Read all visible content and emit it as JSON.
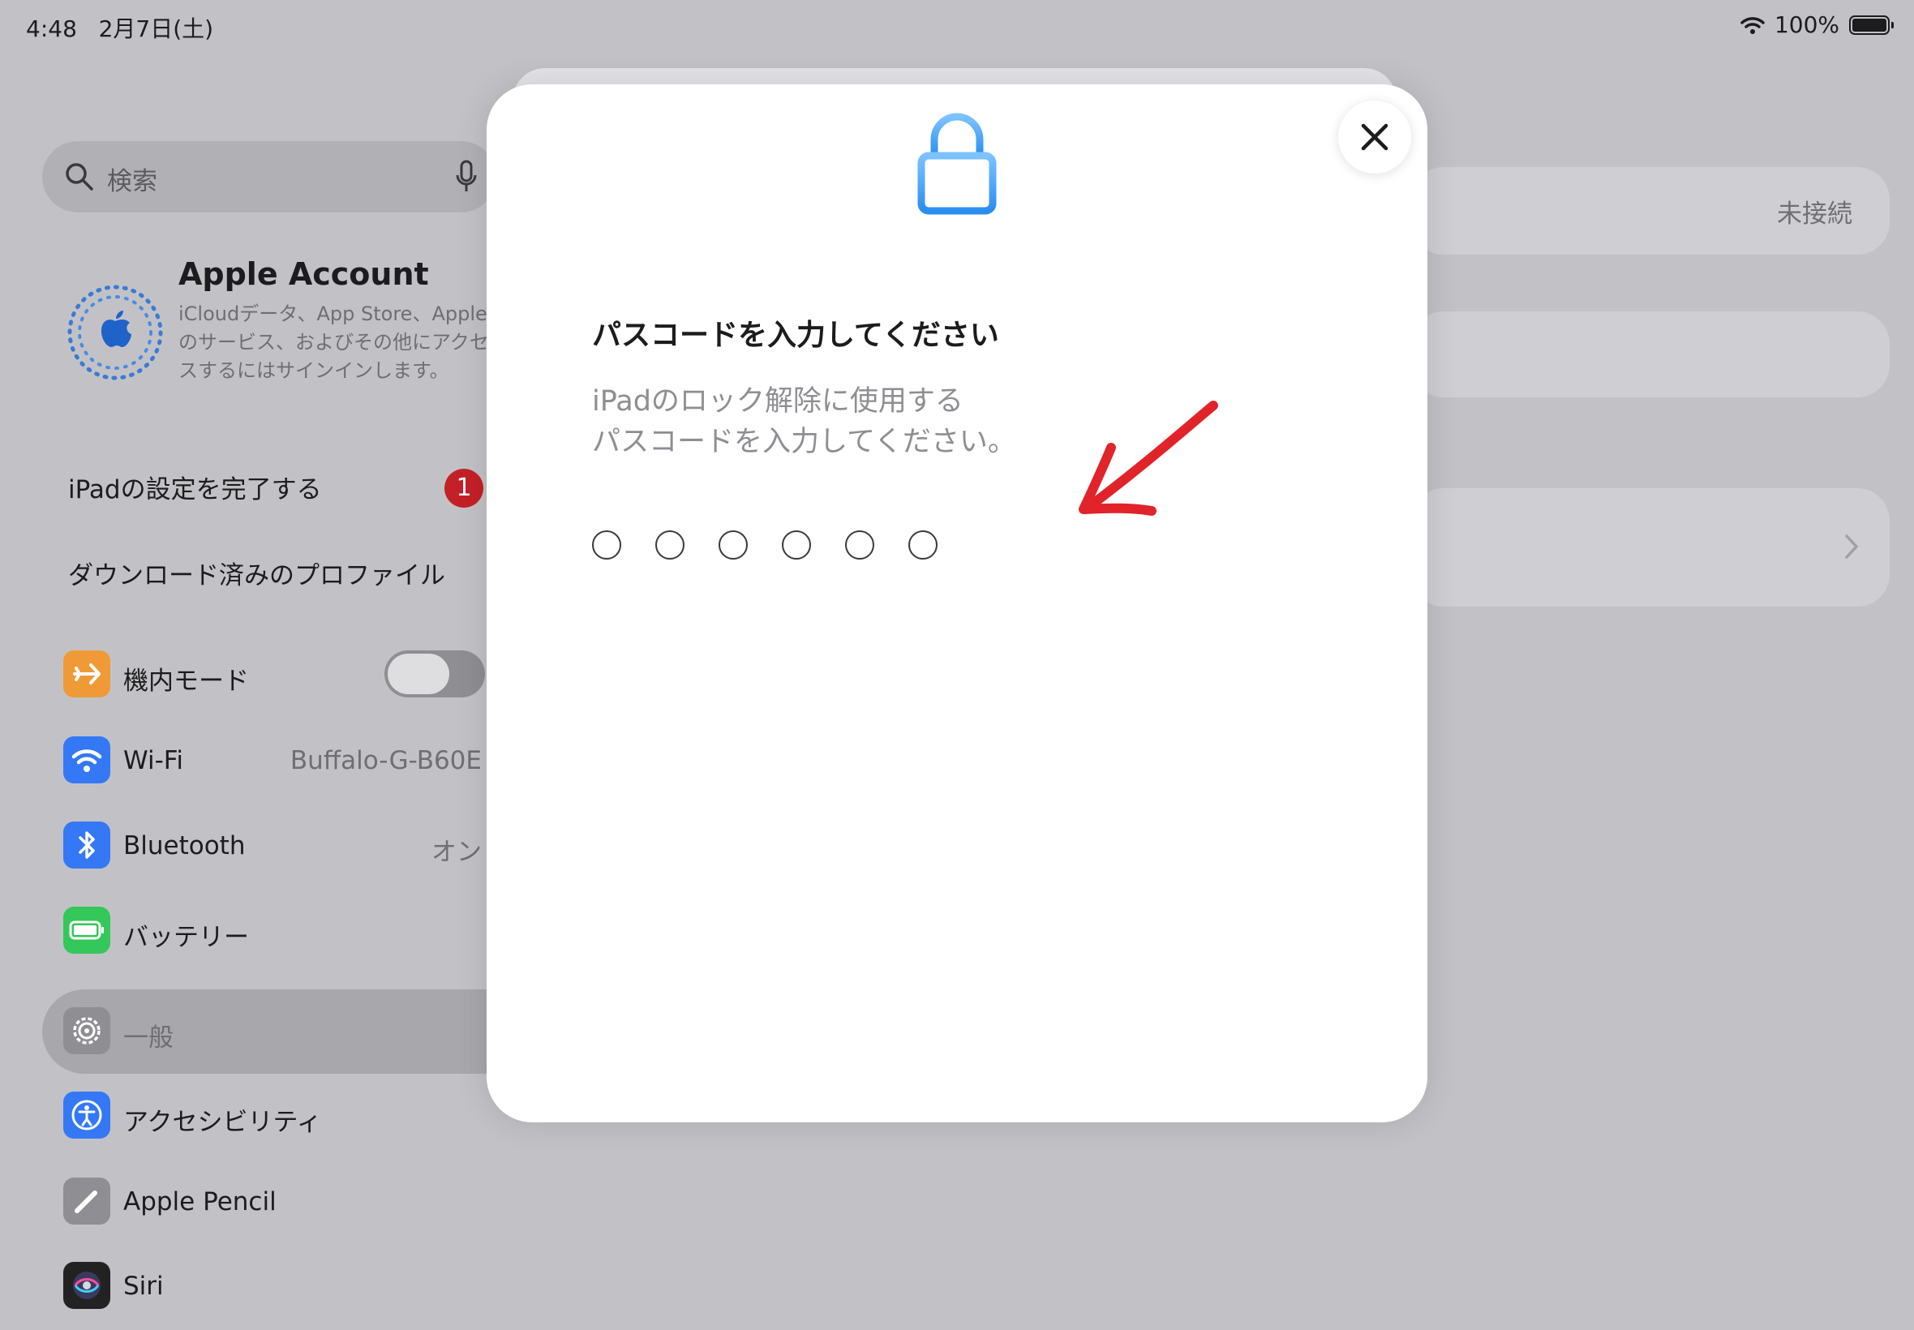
{
  "status_bar": {
    "time": "4:48",
    "date": "2月7日(土)",
    "battery": "100%"
  },
  "sidebar": {
    "search_placeholder": "検索",
    "account": {
      "title": "Apple Account",
      "description": "iCloudデータ、App Store、Appleのサービス、およびその他にアクセスするにはサインインします。"
    },
    "setup": {
      "label": "iPadの設定を完了する",
      "badge": "1"
    },
    "profile": {
      "label": "ダウンロード済みのプロファイル"
    },
    "items": [
      {
        "label": "機内モード",
        "icon": "airplane-icon",
        "color": "#f09a37"
      },
      {
        "label": "Wi-Fi",
        "value": "Buffalo-G-B60E",
        "icon": "wifi-icon",
        "color": "#3478f6"
      },
      {
        "label": "Bluetooth",
        "value": "オン",
        "icon": "bluetooth-icon",
        "color": "#3478f6"
      },
      {
        "label": "バッテリー",
        "icon": "battery-icon",
        "color": "#34c759"
      },
      {
        "label": "一般",
        "icon": "gear-icon",
        "color": "#8e8e93"
      },
      {
        "label": "アクセシビリティ",
        "icon": "accessibility-icon",
        "color": "#3478f6"
      },
      {
        "label": "Apple Pencil",
        "icon": "pencil-icon",
        "color": "#8e8e93"
      },
      {
        "label": "Siri",
        "icon": "siri-icon",
        "color": "#222222"
      }
    ]
  },
  "detail": {
    "status": "未接続"
  },
  "modal": {
    "title": "パスコードを入力してください",
    "description_line1": "iPadのロック解除に使用する",
    "description_line2": "パスコードを入力してください。",
    "passcode_length": 6,
    "accent": "#3a9af3",
    "arrow_color": "#e0242a"
  }
}
